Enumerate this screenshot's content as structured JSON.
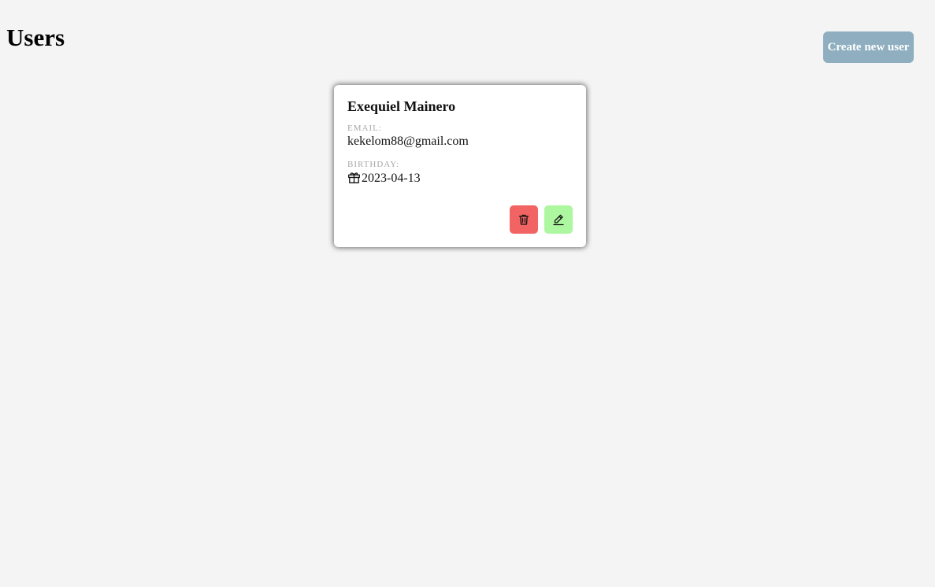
{
  "header": {
    "title": "Users",
    "create_button_label": "Create new user"
  },
  "users": [
    {
      "name": "Exequiel Mainero",
      "email_label": "EMAIL:",
      "email": "kekelom88@gmail.com",
      "birthday_label": "BIRTHDAY:",
      "birthday": "2023-04-13",
      "birthday_icon": "gift-icon",
      "actions": {
        "delete_icon": "trash-icon",
        "edit_icon": "pencil-icon"
      }
    }
  ],
  "colors": {
    "background": "#f4f4f4",
    "create_button": "#8fafc0",
    "delete_button": "#f26464",
    "edit_button": "#adf7a0",
    "label_text": "#a8a8a8"
  }
}
